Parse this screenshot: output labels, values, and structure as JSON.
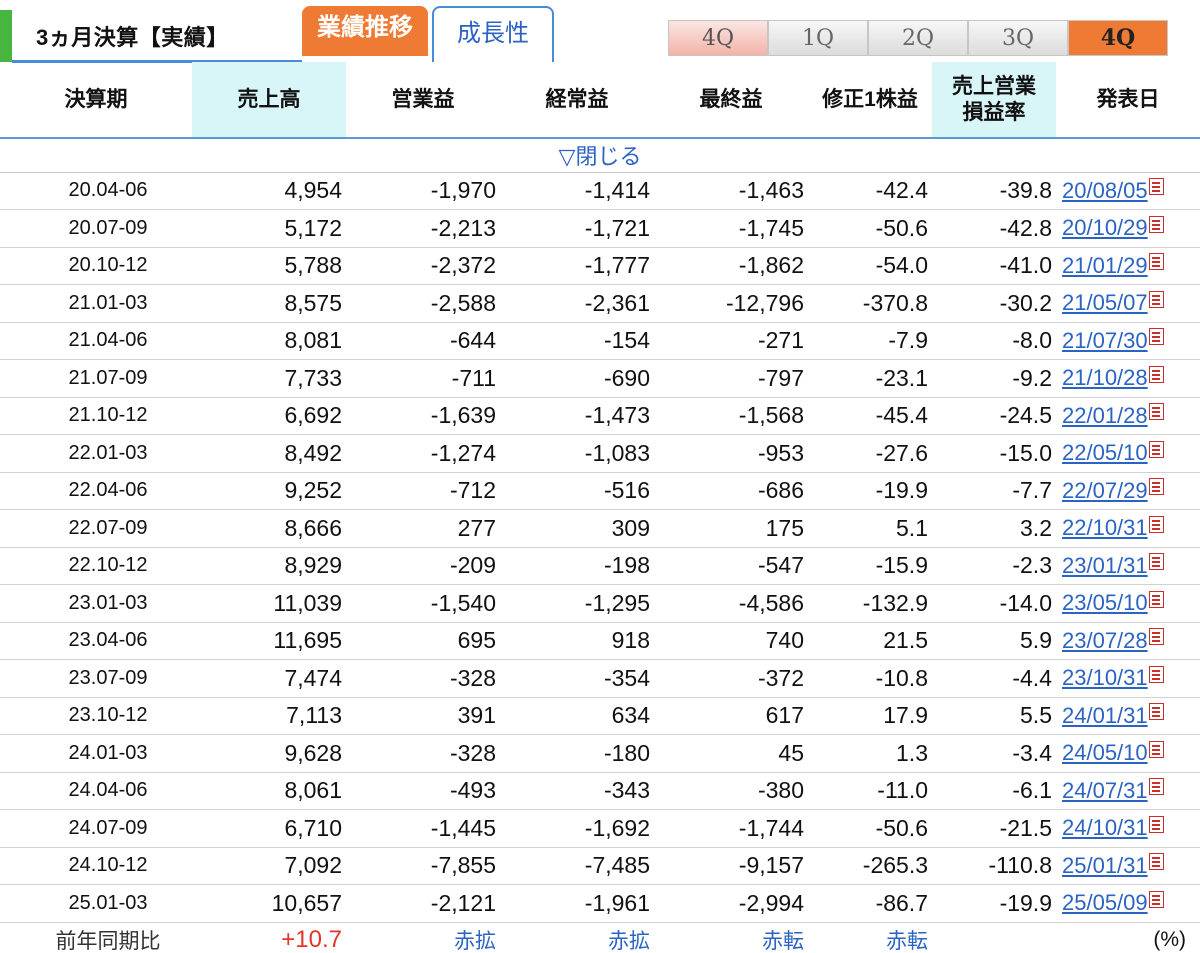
{
  "header": {
    "title": "3ヵ月決算【実績】",
    "tabs": [
      {
        "label": "業績推移",
        "active": true
      },
      {
        "label": "成長性",
        "active": false
      }
    ],
    "quarter_buttons": [
      "4Q",
      "1Q",
      "2Q",
      "3Q",
      "4Q"
    ],
    "selected_quarter_index": 4
  },
  "table": {
    "columns": [
      "決算期",
      "売上高",
      "営業益",
      "経常益",
      "最終益",
      "修正1株益",
      "売上営業\n損益率",
      "発表日"
    ],
    "column_line1": [
      "決算期",
      "売上高",
      "営業益",
      "経常益",
      "最終益",
      "修正1株益",
      "売上営業",
      "発表日"
    ],
    "column_line2": [
      "",
      "",
      "",
      "",
      "",
      "",
      "損益率",
      ""
    ],
    "toggle_label": "▽閉じる",
    "rows": [
      [
        "20.04-06",
        "4,954",
        "-1,970",
        "-1,414",
        "-1,463",
        "-42.4",
        "-39.8",
        "20/08/05"
      ],
      [
        "20.07-09",
        "5,172",
        "-2,213",
        "-1,721",
        "-1,745",
        "-50.6",
        "-42.8",
        "20/10/29"
      ],
      [
        "20.10-12",
        "5,788",
        "-2,372",
        "-1,777",
        "-1,862",
        "-54.0",
        "-41.0",
        "21/01/29"
      ],
      [
        "21.01-03",
        "8,575",
        "-2,588",
        "-2,361",
        "-12,796",
        "-370.8",
        "-30.2",
        "21/05/07"
      ],
      [
        "21.04-06",
        "8,081",
        "-644",
        "-154",
        "-271",
        "-7.9",
        "-8.0",
        "21/07/30"
      ],
      [
        "21.07-09",
        "7,733",
        "-711",
        "-690",
        "-797",
        "-23.1",
        "-9.2",
        "21/10/28"
      ],
      [
        "21.10-12",
        "6,692",
        "-1,639",
        "-1,473",
        "-1,568",
        "-45.4",
        "-24.5",
        "22/01/28"
      ],
      [
        "22.01-03",
        "8,492",
        "-1,274",
        "-1,083",
        "-953",
        "-27.6",
        "-15.0",
        "22/05/10"
      ],
      [
        "22.04-06",
        "9,252",
        "-712",
        "-516",
        "-686",
        "-19.9",
        "-7.7",
        "22/07/29"
      ],
      [
        "22.07-09",
        "8,666",
        "277",
        "309",
        "175",
        "5.1",
        "3.2",
        "22/10/31"
      ],
      [
        "22.10-12",
        "8,929",
        "-209",
        "-198",
        "-547",
        "-15.9",
        "-2.3",
        "23/01/31"
      ],
      [
        "23.01-03",
        "11,039",
        "-1,540",
        "-1,295",
        "-4,586",
        "-132.9",
        "-14.0",
        "23/05/10"
      ],
      [
        "23.04-06",
        "11,695",
        "695",
        "918",
        "740",
        "21.5",
        "5.9",
        "23/07/28"
      ],
      [
        "23.07-09",
        "7,474",
        "-328",
        "-354",
        "-372",
        "-10.8",
        "-4.4",
        "23/10/31"
      ],
      [
        "23.10-12",
        "7,113",
        "391",
        "634",
        "617",
        "17.9",
        "5.5",
        "24/01/31"
      ],
      [
        "24.01-03",
        "9,628",
        "-328",
        "-180",
        "45",
        "1.3",
        "-3.4",
        "24/05/10"
      ],
      [
        "24.04-06",
        "8,061",
        "-493",
        "-343",
        "-380",
        "-11.0",
        "-6.1",
        "24/07/31"
      ],
      [
        "24.07-09",
        "6,710",
        "-1,445",
        "-1,692",
        "-1,744",
        "-50.6",
        "-21.5",
        "24/10/31"
      ],
      [
        "24.10-12",
        "7,092",
        "-7,855",
        "-7,485",
        "-9,157",
        "-265.3",
        "-110.8",
        "25/01/31"
      ],
      [
        "25.01-03",
        "10,657",
        "-2,121",
        "-1,961",
        "-2,994",
        "-86.7",
        "-19.9",
        "25/05/09"
      ]
    ],
    "summary": {
      "label": "前年同期比",
      "sales": "+10.7",
      "operating": "赤拡",
      "ordinary": "赤拡",
      "net": "赤転",
      "eps": "赤転",
      "margin": "",
      "unit": "(%)"
    }
  },
  "colors": {
    "accent_orange": "#ef7a33",
    "accent_blue": "#4a8bd8",
    "link_blue": "#2b63c4",
    "highlight_cyan": "#d8f5f8",
    "green_mark": "#47b63f",
    "positive_red": "#e0362b"
  },
  "icons": {
    "date_suffix": "pdf-document-icon"
  }
}
